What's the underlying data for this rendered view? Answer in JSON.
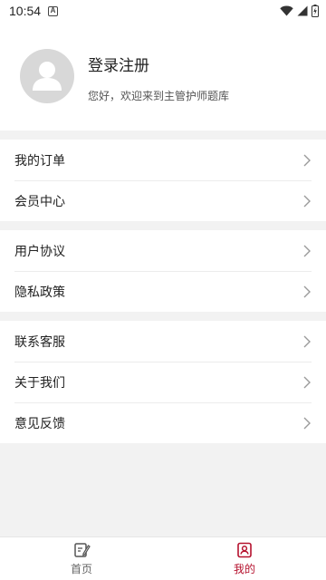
{
  "status_bar": {
    "time": "10:54",
    "notification_icon": "a-icon",
    "wifi_icon": "wifi-icon",
    "signal_icon": "signal-icon",
    "battery_icon": "battery-charging-icon"
  },
  "profile": {
    "avatar_icon": "user-icon",
    "login_label": "登录注册",
    "welcome_text": "您好，欢迎来到主管护师题库"
  },
  "menu_groups": [
    {
      "items": [
        {
          "label": "我的订单"
        },
        {
          "label": "会员中心"
        }
      ]
    },
    {
      "items": [
        {
          "label": "用户协议"
        },
        {
          "label": "隐私政策"
        }
      ]
    },
    {
      "items": [
        {
          "label": "联系客服"
        },
        {
          "label": "关于我们"
        },
        {
          "label": "意见反馈"
        }
      ]
    }
  ],
  "tabbar": {
    "tabs": [
      {
        "label": "首页",
        "icon": "edit-icon",
        "active": false
      },
      {
        "label": "我的",
        "icon": "profile-icon",
        "active": true
      }
    ]
  },
  "colors": {
    "accent": "#b5122e",
    "inactive": "#666666",
    "background": "#f2f2f2",
    "avatar_bg": "#d8d8d8"
  }
}
